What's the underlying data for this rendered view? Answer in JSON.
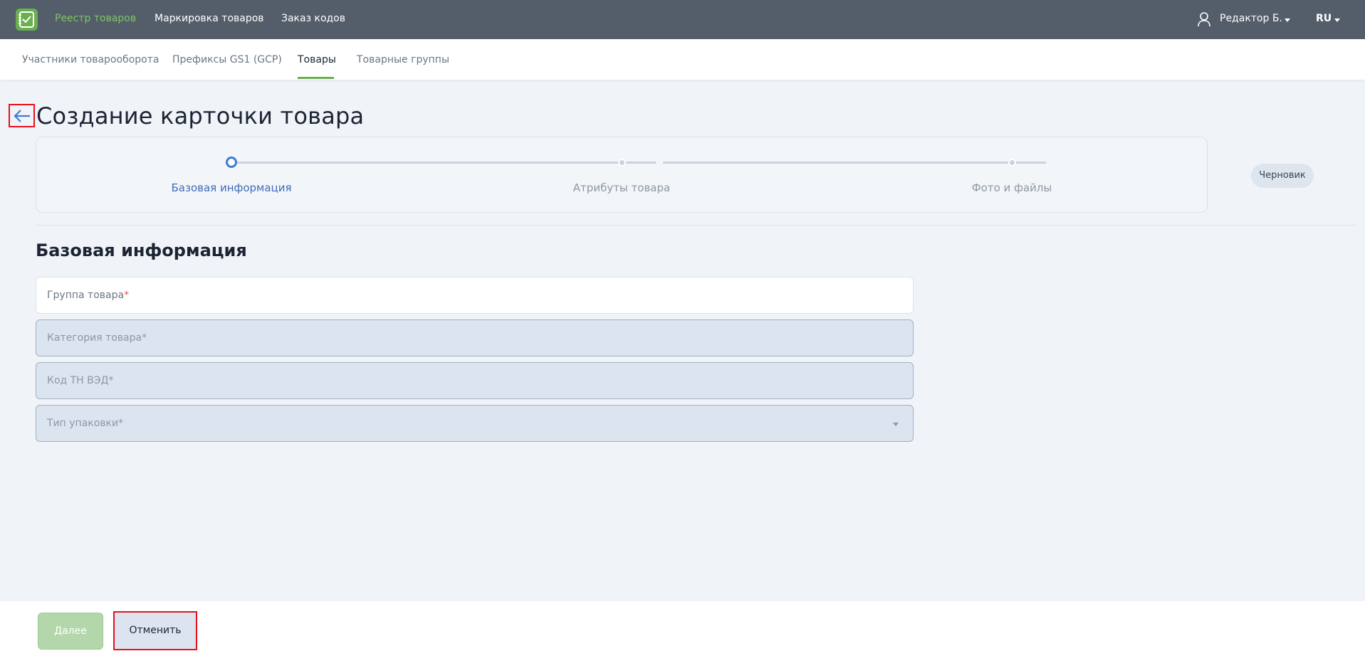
{
  "app": {
    "logo_icon": "checklist-icon",
    "accent_color": "#6aaf4f"
  },
  "topnav": {
    "items": [
      {
        "label": "Реестр товаров",
        "active": true
      },
      {
        "label": "Маркировка товаров",
        "active": false
      },
      {
        "label": "Заказ кодов",
        "active": false
      }
    ],
    "user": {
      "icon": "user-icon",
      "name": "Редактор Б."
    },
    "language": "RU"
  },
  "subnav": {
    "tabs": [
      {
        "label": "Участники товарооборота",
        "active": false
      },
      {
        "label": "Префиксы GS1 (GCP)",
        "active": false
      },
      {
        "label": "Товары",
        "active": true
      },
      {
        "label": "Товарные группы",
        "active": false
      }
    ]
  },
  "page": {
    "back_icon": "arrow-left-icon",
    "title": "Создание карточки товара"
  },
  "stepper": {
    "steps": [
      {
        "label": "Базовая информация",
        "state": "current"
      },
      {
        "label": "Атрибуты товара",
        "state": "pending"
      },
      {
        "label": "Фото и файлы",
        "state": "pending"
      }
    ],
    "status_badge": "Черновик"
  },
  "form": {
    "section_title": "Базовая информация",
    "fields": [
      {
        "label": "Группа товара",
        "required_mark": "*",
        "value": "",
        "disabled": false,
        "type": "text"
      },
      {
        "label": "Категория товара",
        "required_mark": "*",
        "value": "",
        "disabled": true,
        "type": "text"
      },
      {
        "label": "Код ТН ВЭД",
        "required_mark": "*",
        "value": "",
        "disabled": true,
        "type": "text"
      },
      {
        "label": "Тип упаковки",
        "required_mark": "*",
        "value": "",
        "disabled": true,
        "type": "select"
      }
    ]
  },
  "footer": {
    "next_label": "Далее",
    "cancel_label": "Отменить"
  }
}
